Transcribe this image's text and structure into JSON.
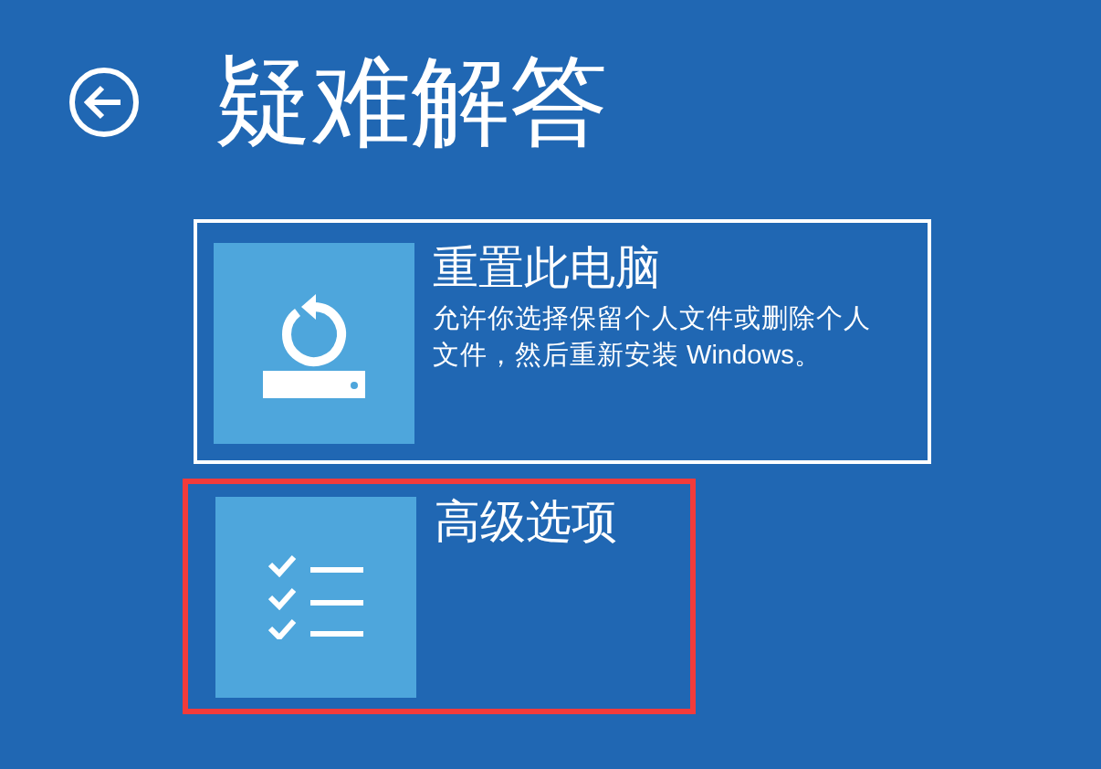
{
  "header": {
    "title": "疑难解答"
  },
  "options": [
    {
      "kind": "reset",
      "title": "重置此电脑",
      "description": "允许你选择保留个人文件或删除个人文件，然后重新安装 Windows。",
      "selected": true,
      "highlighted": false
    },
    {
      "kind": "advanced",
      "title": "高级选项",
      "selected": false,
      "highlighted": true
    }
  ]
}
